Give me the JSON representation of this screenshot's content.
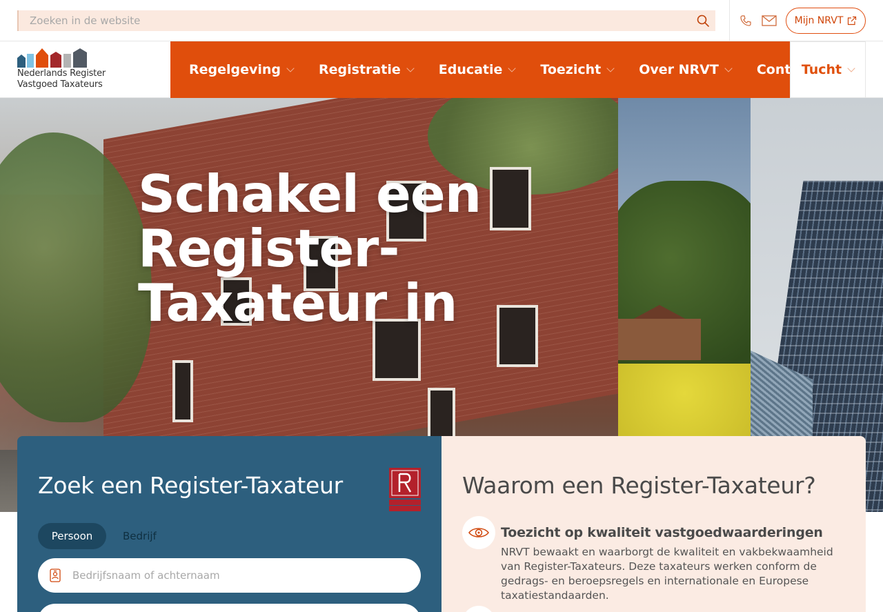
{
  "topbar": {
    "search_placeholder": "Zoeken in de website",
    "mijn_label": "Mijn NRVT"
  },
  "logo": {
    "line1": "Nederlands Register",
    "line2": "Vastgoed Taxateurs"
  },
  "nav": {
    "items": [
      {
        "label": "Regelgeving"
      },
      {
        "label": "Registratie"
      },
      {
        "label": "Educatie"
      },
      {
        "label": "Toezicht"
      },
      {
        "label": "Over NRVT"
      },
      {
        "label": "Contact"
      }
    ],
    "tucht_label": "Tucht"
  },
  "hero": {
    "title": "Schakel een Register-Taxateur in"
  },
  "search_card": {
    "title": "Zoek een Register-Taxateur",
    "tabs": [
      "Persoon",
      "Bedrijf"
    ],
    "name_placeholder": "Bedrijfsnaam of achternaam"
  },
  "why_card": {
    "title": "Waarom een Register-Taxateur?",
    "items": [
      {
        "title": "Toezicht op kwaliteit vastgoedwaarderingen",
        "text": "NRVT bewaakt en waarborgt de kwaliteit en vakbekwaamheid van Register-Taxateurs. Deze taxateurs werken conform de gedrags- en beroepsregels en internationale en Europese taxatiestandaarden."
      }
    ]
  },
  "colors": {
    "brand_orange": "#e04e0c",
    "search_card_blue": "#2d5f7e",
    "why_card_bg": "#fbebe3"
  }
}
